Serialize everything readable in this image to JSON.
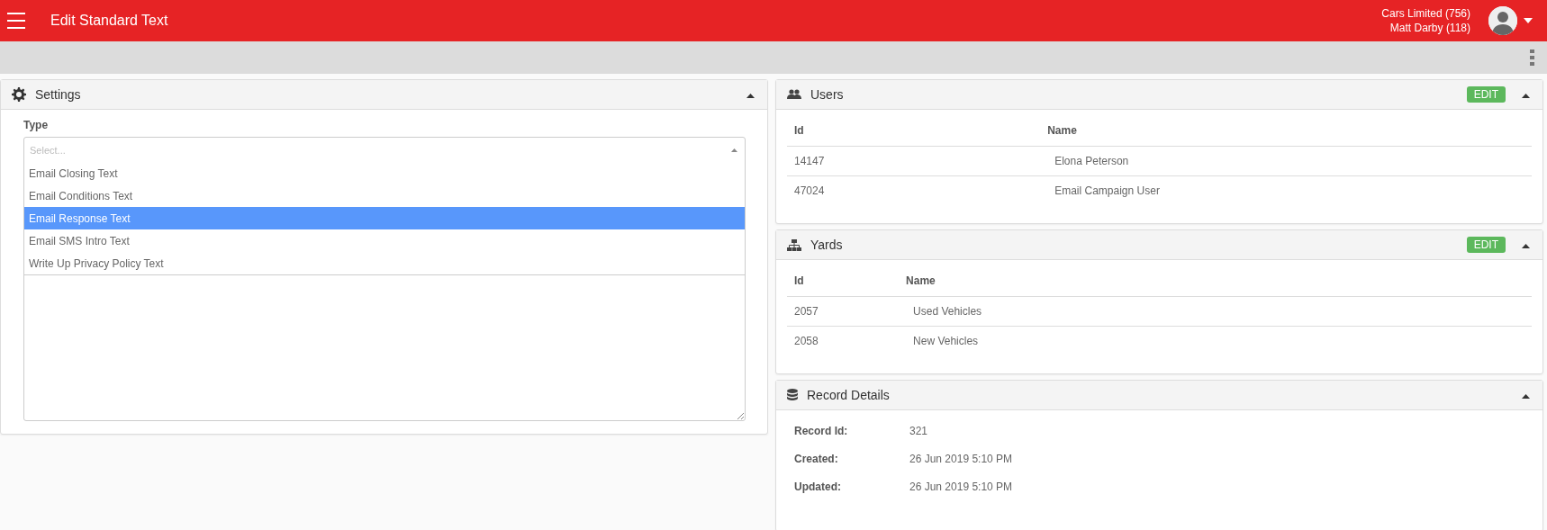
{
  "header": {
    "title": "Edit Standard Text",
    "company": "Cars Limited (756)",
    "user": "Matt Darby (118)"
  },
  "settings": {
    "title": "Settings",
    "expanded": true,
    "type_label": "Type",
    "placeholder": "Select...",
    "options": [
      {
        "label": "Email Closing Text",
        "selected": false
      },
      {
        "label": "Email Conditions Text",
        "selected": false
      },
      {
        "label": "Email Response Text",
        "selected": true
      },
      {
        "label": "Email SMS Intro Text",
        "selected": false
      },
      {
        "label": "Write Up Privacy Policy Text",
        "selected": false
      }
    ]
  },
  "panels": [
    {
      "kind": "table",
      "title": "Users",
      "edit": "EDIT",
      "expanded": true,
      "columns": [
        "Id",
        "Name"
      ],
      "rows": [
        [
          "14147",
          "Elona Peterson"
        ],
        [
          "47024",
          "Email Campaign User"
        ]
      ]
    },
    {
      "kind": "table",
      "title": "Yards",
      "edit": "EDIT",
      "expanded": true,
      "columns": [
        "Id",
        "Name"
      ],
      "rows": [
        [
          "2057",
          "Used Vehicles"
        ],
        [
          "2058",
          "New Vehicles"
        ]
      ]
    },
    {
      "kind": "details",
      "title": "Record Details",
      "expanded": true,
      "fields": [
        {
          "label": "Record Id:",
          "value": "321"
        },
        {
          "label": "Created:",
          "value": "26 Jun 2019 5:10 PM"
        },
        {
          "label": "Updated:",
          "value": "26 Jun 2019 5:10 PM"
        }
      ]
    }
  ]
}
